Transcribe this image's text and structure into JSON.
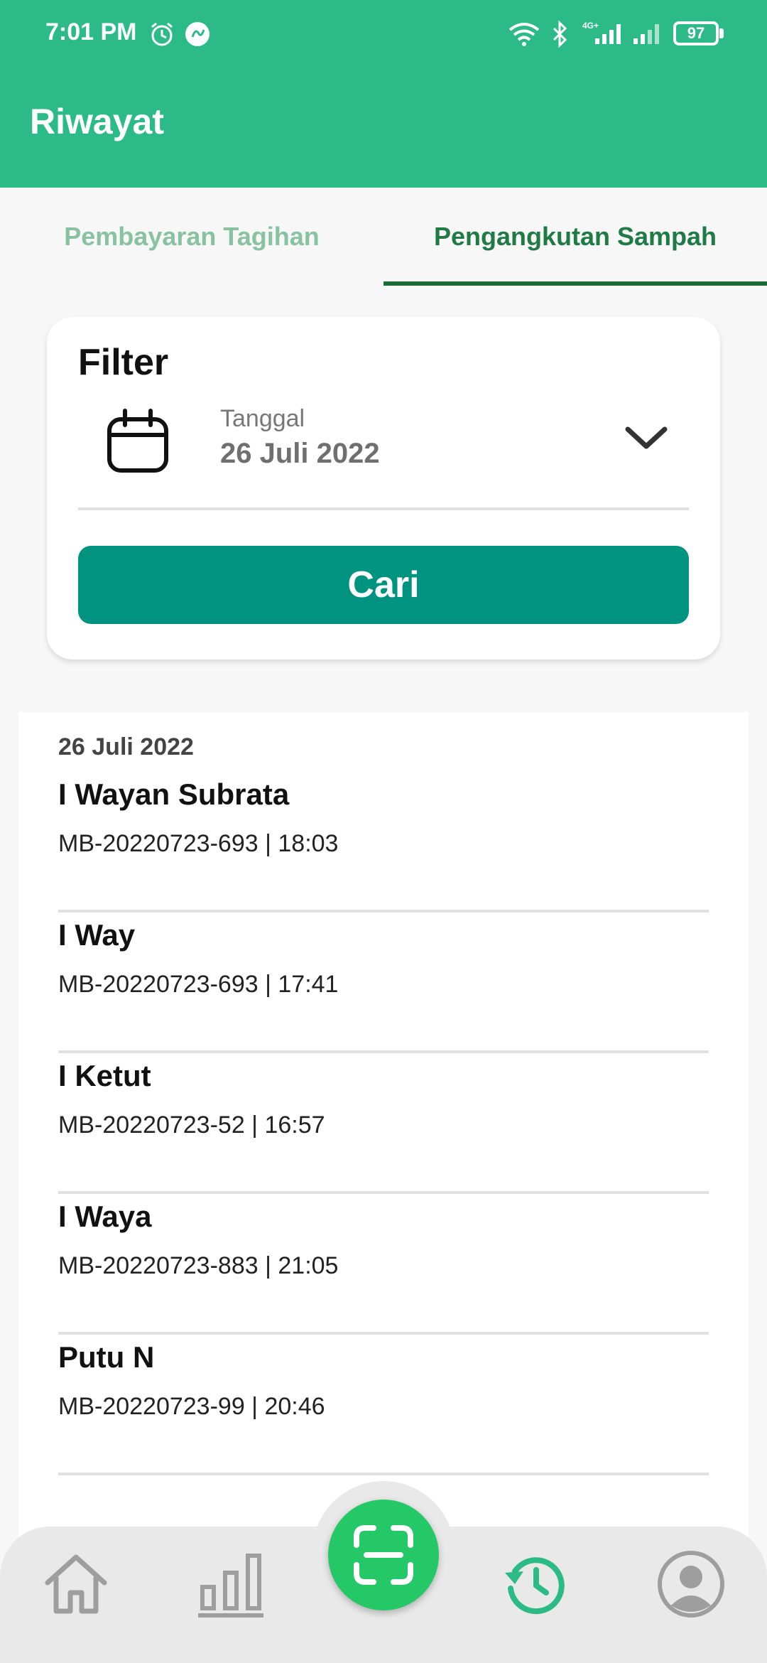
{
  "status_bar": {
    "time": "7:01 PM",
    "icons": [
      "alarm-icon",
      "flip-app-icon",
      "wifi-icon",
      "bluetooth-icon",
      "signal-4g-icon",
      "signal-icon"
    ],
    "battery": "97"
  },
  "app_bar": {
    "title": "Riwayat"
  },
  "tabs": [
    {
      "label": "Pembayaran Tagihan",
      "active": false
    },
    {
      "label": "Pengangkutan Sampah",
      "active": true
    }
  ],
  "filter": {
    "title": "Filter",
    "date_label": "Tanggal",
    "date_value": "26 Juli 2022",
    "search_label": "Cari"
  },
  "history": {
    "date_header": "26 Juli 2022",
    "items": [
      {
        "name": "I Wayan Subrata",
        "meta": "MB-20220723-693 | 18:03"
      },
      {
        "name": "I Way",
        "meta": "MB-20220723-693 | 17:41"
      },
      {
        "name": "I Ketut",
        "meta": "MB-20220723-52 | 16:57"
      },
      {
        "name": "I Waya",
        "meta": "MB-20220723-883 | 21:05"
      },
      {
        "name": "Putu N",
        "meta": "MB-20220723-99 | 20:46"
      }
    ]
  },
  "bottom_nav": {
    "items": [
      "home-icon",
      "chart-icon",
      "scan-icon",
      "history-icon",
      "profile-icon"
    ],
    "active": "history-icon",
    "colors": {
      "accent": "#2bba88",
      "fab": "#24c867",
      "inactive": "#9e9e9e"
    }
  }
}
